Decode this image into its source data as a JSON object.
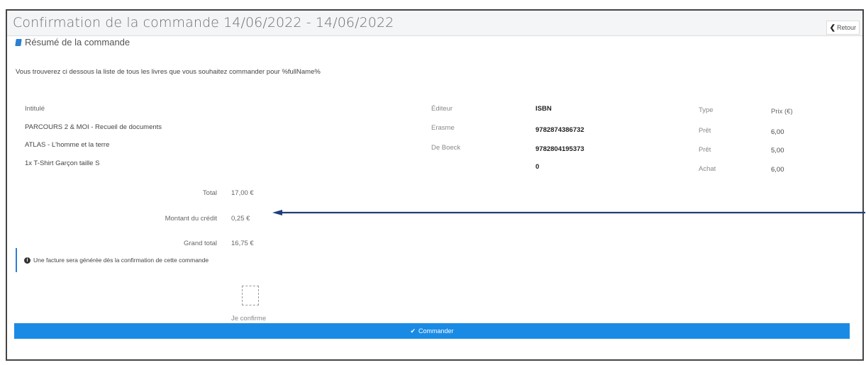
{
  "page": {
    "title": "Confirmation de la commande 14/06/2022 - 14/06/2022",
    "back_label": "Retour"
  },
  "summary": {
    "title": "Résumé de la commande",
    "intro": "Vous trouverez ci dessous la liste de tous les livres que vous souhaitez commander pour %fullName%"
  },
  "table": {
    "headers": {
      "title": "Intitulé",
      "publisher": "Éditeur",
      "isbn": "ISBN",
      "type": "Type",
      "price": "Prix (€)"
    },
    "rows": [
      {
        "title": "PARCOURS 2 & MOI - Recueil de documents",
        "publisher": "Erasme",
        "isbn": "9782874386732",
        "type": "Prêt",
        "price": "6,00"
      },
      {
        "title": "ATLAS - L'homme et la terre",
        "publisher": "De Boeck",
        "isbn": "9782804195373",
        "type": "Prêt",
        "price": "5,00"
      },
      {
        "title": "1x T-Shirt Garçon taille S",
        "publisher": "",
        "isbn": "0",
        "type": "Achat",
        "price": "6,00"
      }
    ]
  },
  "totals": {
    "total_label": "Total",
    "total_value": "17,00 €",
    "credit_label": "Montant du crédit",
    "credit_value": "0,25 €",
    "grand_label": "Grand total",
    "grand_value": "16,75 €"
  },
  "info": {
    "text": "Une facture sera générée dès la confirmation de cette commande"
  },
  "confirm": {
    "label": "Je confirme"
  },
  "order_button": {
    "label": "Commander"
  },
  "icons": {
    "back": "chevron-left-icon",
    "summary": "book-icon",
    "info": "info-circle-icon",
    "order": "check-icon"
  },
  "colors": {
    "accent": "#1a8be5",
    "arrow": "#1e3f7a"
  }
}
